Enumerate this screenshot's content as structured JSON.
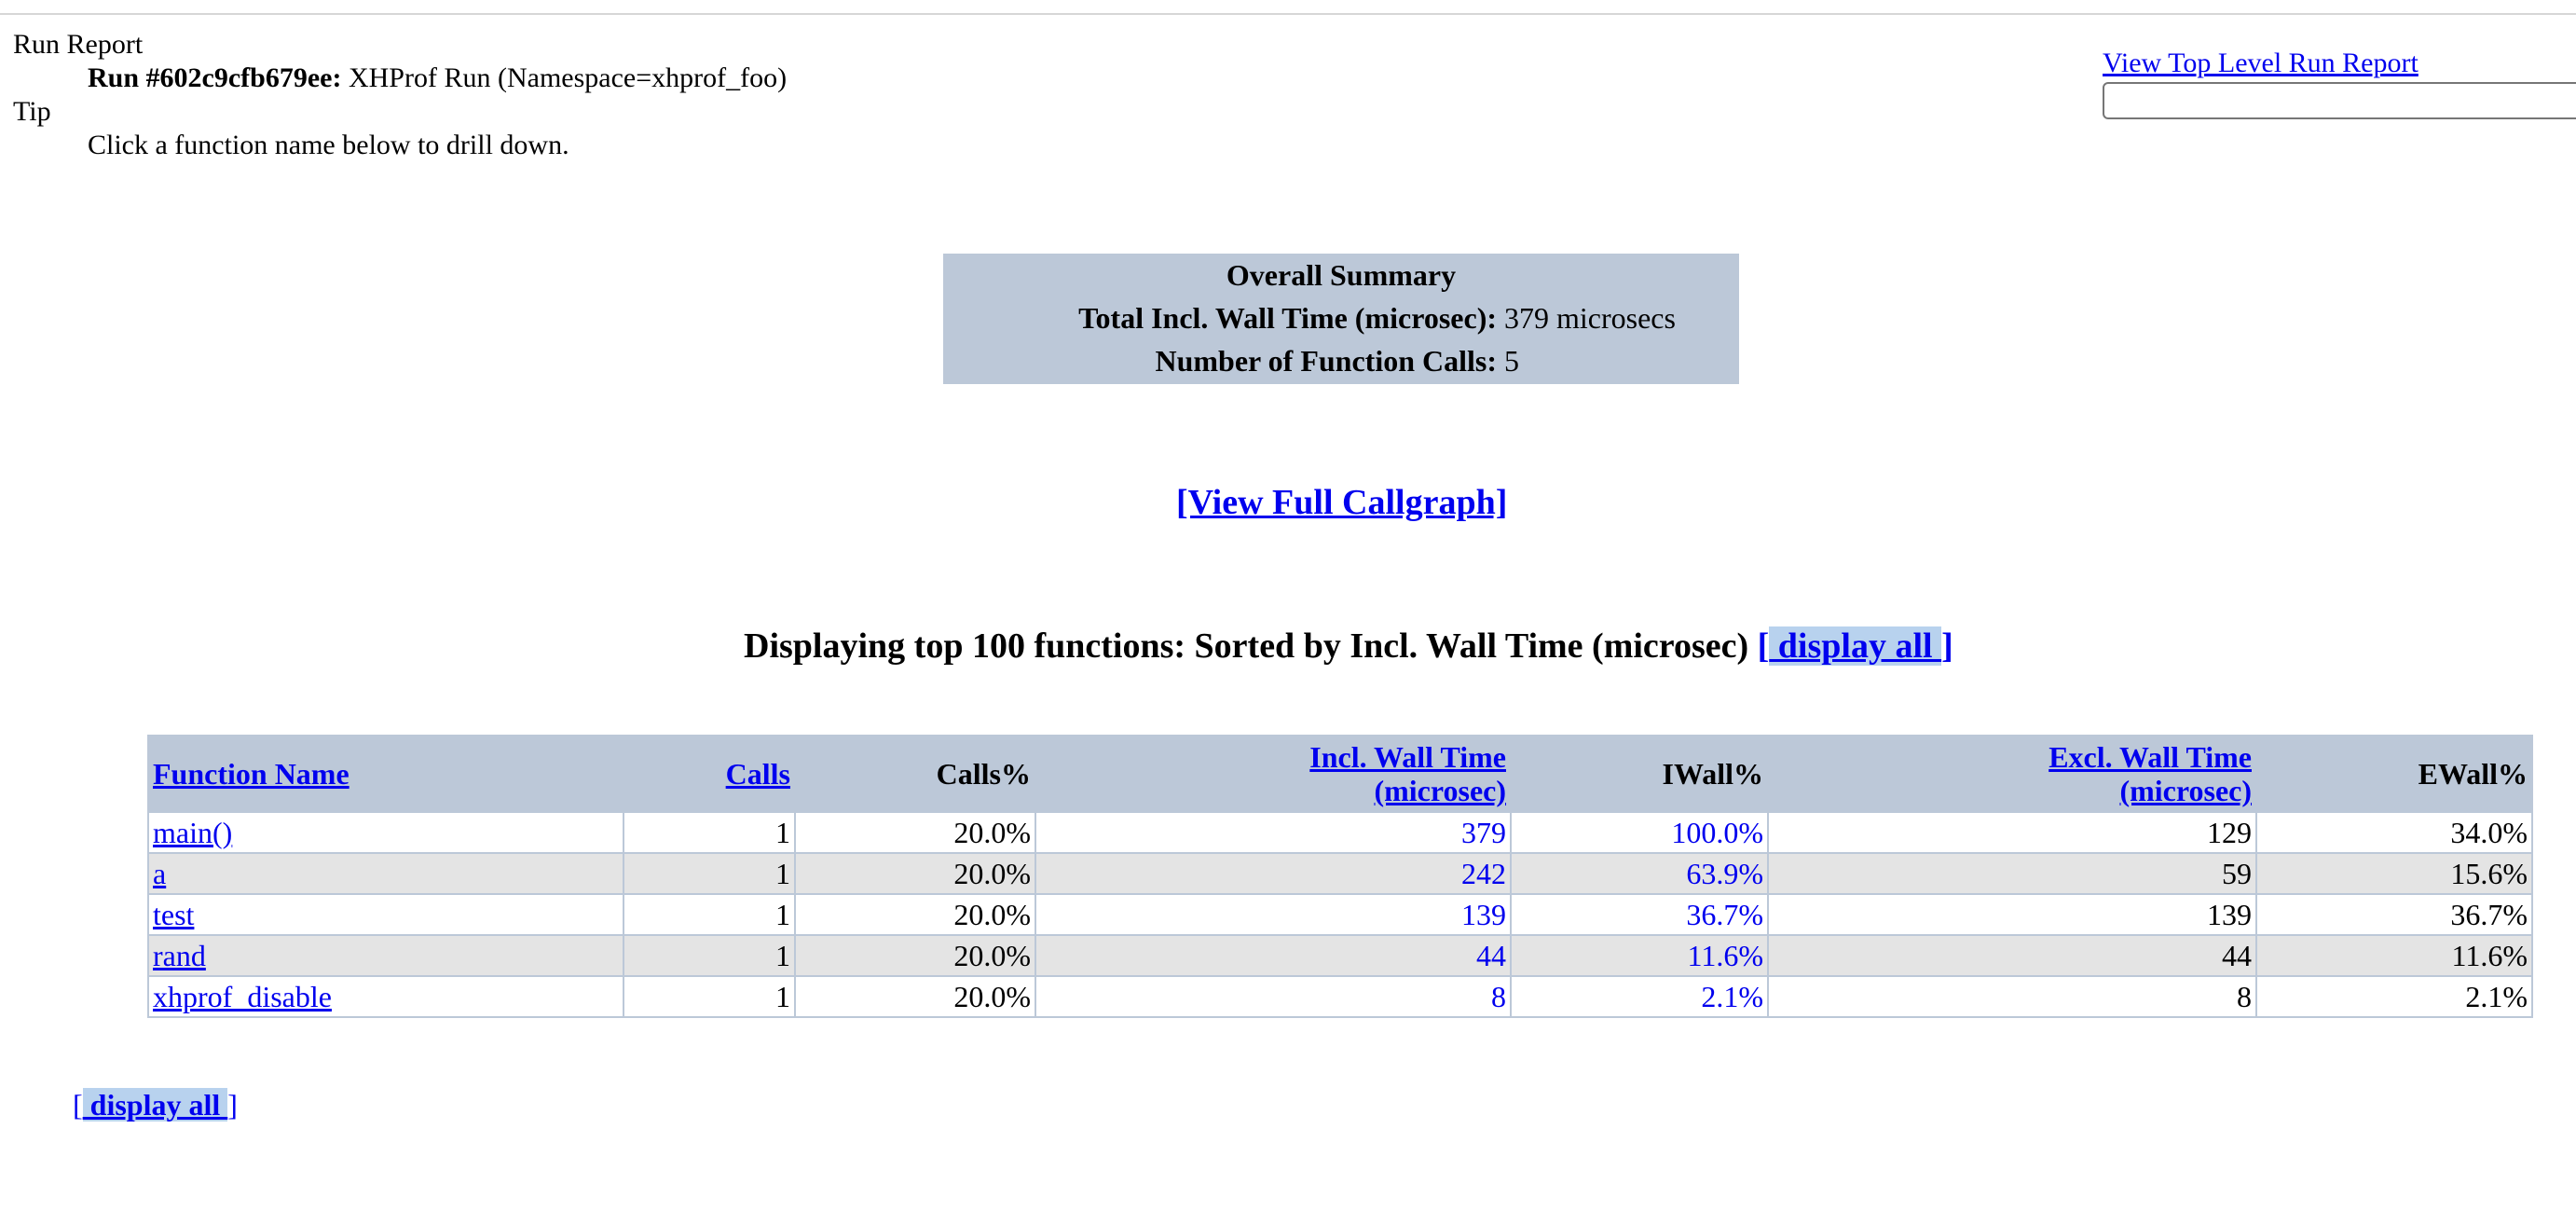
{
  "header": {
    "run_report_label": "Run Report",
    "run_id_label": "Run #602c9cfb679ee:",
    "run_desc": "XHProf Run (Namespace=xhprof_foo)",
    "tip_label": "Tip",
    "tip_text": "Click a function name below to drill down.",
    "top_level_link": "View Top Level Run Report",
    "search_value": ""
  },
  "summary": {
    "title": "Overall Summary",
    "rows": [
      {
        "label": "Total Incl. Wall Time (microsec):",
        "value": "379 microsecs"
      },
      {
        "label": "Number of Function Calls:",
        "value": "5"
      }
    ]
  },
  "callgraph_link": "[View Full Callgraph]",
  "listing": {
    "heading": "Displaying top 100 functions: Sorted by Incl. Wall Time (microsec)",
    "display_all_open": "[",
    "display_all_label": " display all ",
    "display_all_close": "]"
  },
  "table": {
    "columns": [
      {
        "label": "Function Name",
        "link": true
      },
      {
        "label": "Calls",
        "link": true
      },
      {
        "label": "Calls%",
        "link": false
      },
      {
        "label": "Incl. Wall Time (microsec)",
        "label_line1": "Incl. Wall Time",
        "label_line2": "(microsec)",
        "link": true
      },
      {
        "label": "IWall%",
        "link": false
      },
      {
        "label": "Excl. Wall Time (microsec)",
        "label_line1": "Excl. Wall Time",
        "label_line2": "(microsec)",
        "link": true
      },
      {
        "label": "EWall%",
        "link": false
      }
    ],
    "rows": [
      {
        "name": "main()",
        "calls": "1",
        "calls_pct": "20.0%",
        "incl": "379",
        "iwall_pct": "100.0%",
        "excl": "129",
        "ewall_pct": "34.0%"
      },
      {
        "name": "a",
        "calls": "1",
        "calls_pct": "20.0%",
        "incl": "242",
        "iwall_pct": "63.9%",
        "excl": "59",
        "ewall_pct": "15.6%"
      },
      {
        "name": "test",
        "calls": "1",
        "calls_pct": "20.0%",
        "incl": "139",
        "iwall_pct": "36.7%",
        "excl": "139",
        "ewall_pct": "36.7%"
      },
      {
        "name": "rand",
        "calls": "1",
        "calls_pct": "20.0%",
        "incl": "44",
        "iwall_pct": "11.6%",
        "excl": "44",
        "ewall_pct": "11.6%"
      },
      {
        "name": "xhprof_disable",
        "calls": "1",
        "calls_pct": "20.0%",
        "incl": "8",
        "iwall_pct": "2.1%",
        "excl": "8",
        "ewall_pct": "2.1%"
      }
    ]
  },
  "footer": {
    "display_all_open": "[",
    "display_all_label": " display all ",
    "display_all_close": "]"
  },
  "colors": {
    "link": "#0000ee",
    "header_bg": "#bcc8d8",
    "even_row_bg": "#e4e4e4"
  }
}
